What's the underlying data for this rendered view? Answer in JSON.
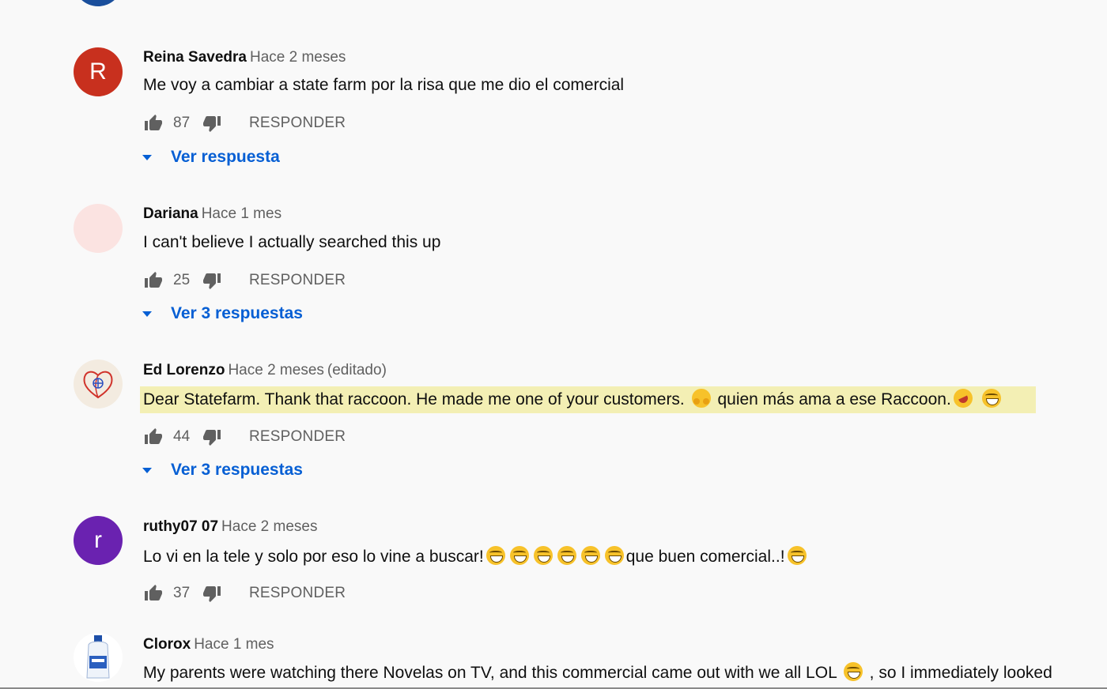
{
  "colors": {
    "background": "#f9f9f9",
    "accent_link": "#065fd4",
    "secondary_text": "#606060",
    "highlight": "#f3efb4"
  },
  "comments": [
    {
      "author": "Reina Savedra",
      "time": "Hace 2 meses",
      "avatar_letter": "R",
      "avatar_color": "#c8301e",
      "text": "Me voy a cambiar a state farm por la risa que me dio el comercial",
      "likes": "87",
      "reply_label": "RESPONDER",
      "view_replies": "Ver respuesta"
    },
    {
      "author": "Dariana",
      "time": "Hace 1 mes",
      "avatar_letter": "",
      "avatar_color": "#fbe3e1",
      "text": "I can't believe I actually searched this up",
      "likes": "25",
      "reply_label": "RESPONDER",
      "view_replies": "Ver 3 respuestas"
    },
    {
      "author": "Ed Lorenzo",
      "time": "Hace 2 meses",
      "edited": "(editado)",
      "avatar_icon": "heart-globe-icon",
      "text_part1": "Dear Statefarm. Thank that raccoon. He made me one of your customers.",
      "text_part2": "quien más ama a ese Raccoon.",
      "likes": "44",
      "reply_label": "RESPONDER",
      "view_replies": "Ver 3 respuestas"
    },
    {
      "author": "ruthy07 07",
      "time": "Hace 2 meses",
      "avatar_letter": "r",
      "avatar_color": "#6a22b0",
      "text_part1": "Lo vi en la tele y solo por eso lo vine a buscar!",
      "text_part2": "que buen comercial..!",
      "likes": "37",
      "reply_label": "RESPONDER"
    },
    {
      "author": "Clorox",
      "time": "Hace 1 mes",
      "avatar_icon": "clorox-bottle-icon",
      "text_part1": "My parents were watching there Novelas on TV, and this commercial came out with we all LOL",
      "text_part2": ", so I immediately looked"
    }
  ]
}
